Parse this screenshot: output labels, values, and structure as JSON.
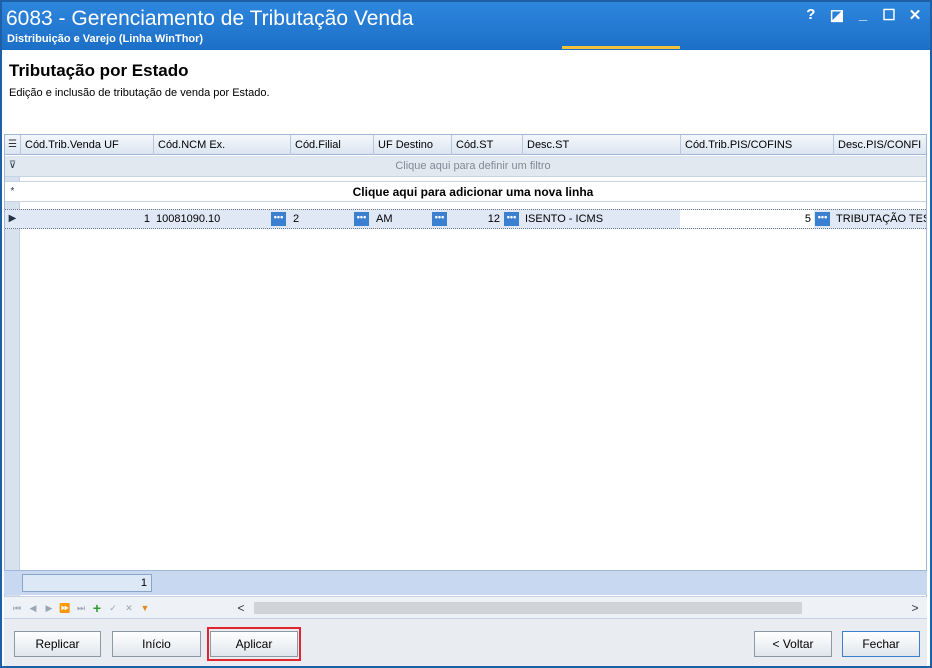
{
  "window": {
    "title": "6083 - Gerenciamento de Tributação Venda",
    "subtitle": "Distribuição e Varejo (Linha WinThor)",
    "controls": [
      "?",
      "◪",
      "_",
      "☐",
      "✕"
    ]
  },
  "page": {
    "title": "Tributação por Estado",
    "description": "Edição e inclusão de tributação de venda por Estado."
  },
  "grid": {
    "columns": [
      "Cód.Trib.Venda UF",
      "Cód.NCM Ex.",
      "Cód.Filial",
      "UF Destino",
      "Cód.ST",
      "Desc.ST",
      "Cód.Trib.PIS/COFINS",
      "Desc.PIS/CONFI"
    ],
    "filter_text": "Clique aqui para definir um filtro",
    "new_row_text": "Clique aqui para adicionar uma nova linha",
    "rows": [
      {
        "cod_trib_venda_uf": "1",
        "cod_ncm_ex": "10081090.10",
        "cod_filial": "2",
        "uf_destino": "AM",
        "cod_st": "12",
        "desc_st": "ISENTO - ICMS",
        "cod_trib_pis_cofins": "5",
        "desc_pis_cofins": "TRIBUTAÇÃO TES"
      }
    ],
    "ellipsis": "•••",
    "footer_count": "1"
  },
  "navigator": {
    "buttons": [
      "⏮",
      "◀",
      "▶",
      "⏩",
      "⏭",
      "+",
      "✓",
      "✕",
      "▼"
    ],
    "scroll_left": "<",
    "scroll_right": ">"
  },
  "buttons": {
    "replicar": "Replicar",
    "inicio": "Início",
    "aplicar": "Aplicar",
    "voltar": "< Voltar",
    "fechar": "Fechar"
  },
  "colors": {
    "titlebar": "#1c6fc6",
    "highlight": "#e0262c"
  }
}
